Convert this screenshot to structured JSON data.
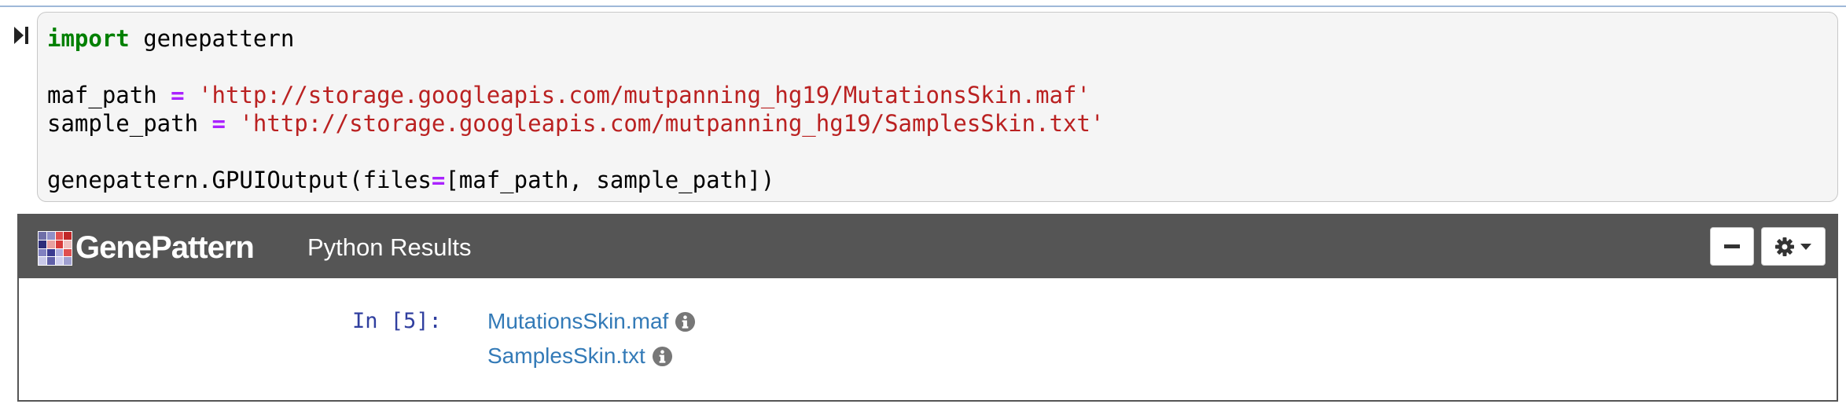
{
  "code_cell": {
    "lines": [
      {
        "kw": "import",
        "rest": " genepattern"
      },
      {
        "name": "maf_path",
        "op": "=",
        "str": "'http://storage.googleapis.com/mutpanning_hg19/MutationsSkin.maf'"
      },
      {
        "name": "sample_path",
        "op": "=",
        "str": "'http://storage.googleapis.com/mutpanning_hg19/SamplesSkin.txt'"
      },
      {
        "call_pre": "genepattern.GPUIOutput(files",
        "op": "=",
        "call_post": "[maf_path, sample_path])"
      }
    ]
  },
  "widget": {
    "logo_text": "GenePattern",
    "title": "Python Results",
    "prompt": "In [5]:",
    "files": [
      {
        "name": "MutationsSkin.maf"
      },
      {
        "name": "SamplesSkin.txt"
      }
    ]
  },
  "colors": {
    "header_bg": "#555555",
    "link": "#337ab7",
    "prompt": "#303f9f",
    "keyword": "#008000",
    "operator": "#aa22ff",
    "string": "#ba2121"
  },
  "icons": {
    "run": "run-cell-icon",
    "logo": "genepattern-logo-icon",
    "minimize": "minus-icon",
    "settings": "gear-icon",
    "caret": "caret-down-icon",
    "info": "info-circle-icon"
  }
}
